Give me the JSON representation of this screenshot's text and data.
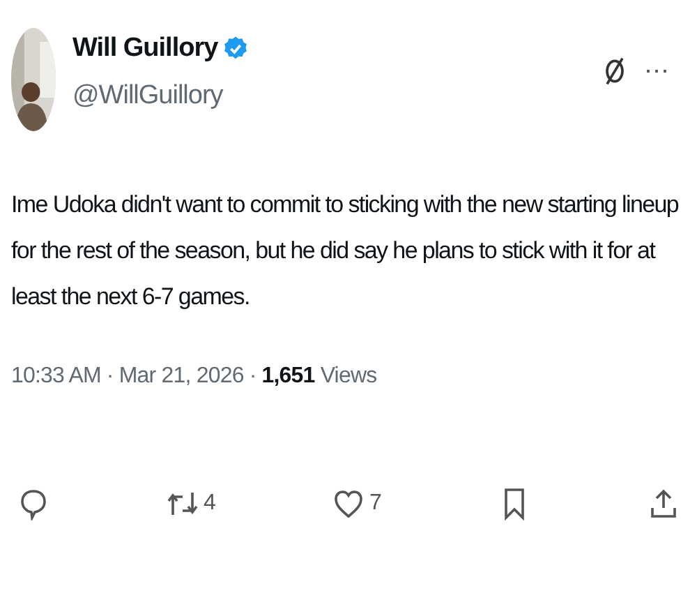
{
  "author": {
    "name": "Will Guillory",
    "verified": true,
    "handle": "@WillGuillory"
  },
  "header_actions": [
    "⋯"
  ],
  "text": "Ime Udoka didn't want to commit to sticking with the new starting lineup for the rest of the season, but he did say he plans to stick with it for at least the next 6-7 games.",
  "meta": [
    {
      "kind": "time",
      "text": "10:33 AM"
    },
    {
      "kind": "separator",
      "text": "·"
    },
    {
      "kind": "date",
      "text": "Mar 21, 2026"
    },
    {
      "kind": "separator",
      "text": "·"
    },
    {
      "kind": "views_count",
      "text": "1,651"
    },
    {
      "kind": "views_label",
      "text": "Views"
    }
  ],
  "actions": [
    {
      "kind": "reply"
    },
    {
      "kind": "repost",
      "count": "4"
    },
    {
      "kind": "like",
      "count": "7"
    },
    {
      "kind": "bookmark"
    },
    {
      "kind": "share"
    }
  ]
}
